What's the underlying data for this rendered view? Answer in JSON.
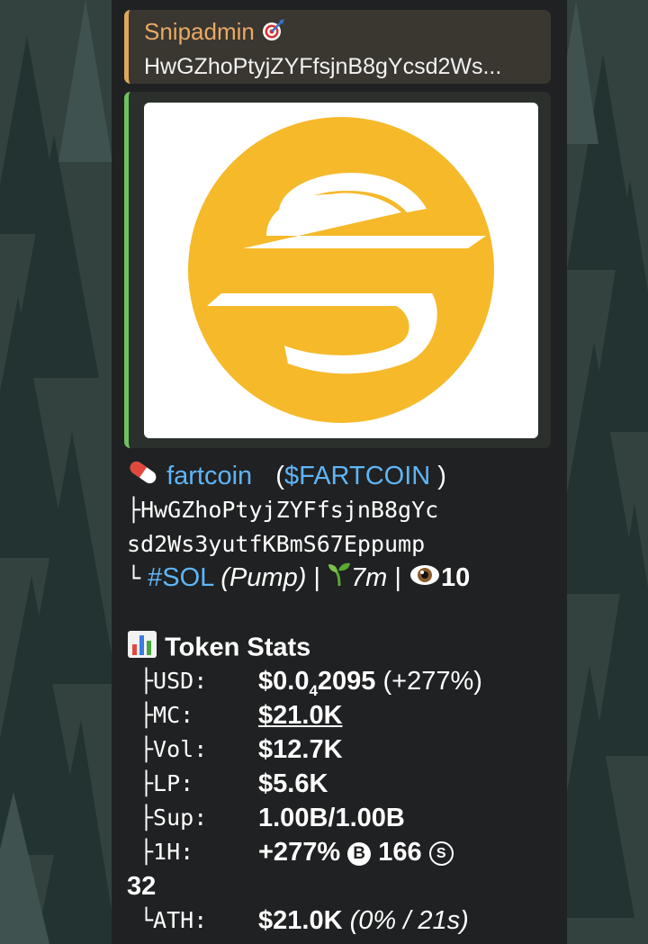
{
  "reply": {
    "sender": "Snipadmin",
    "sender_icon": "target-icon",
    "text": "HwGZhoPtyjZYFfsjnB8gYcsd2Ws..."
  },
  "preview": {
    "image_icon": "s-coin-logo-icon",
    "logo_color": "#F5B92A"
  },
  "token": {
    "name": "fartcoin",
    "symbol_open": "(",
    "symbol": "$FARTCOIN",
    "symbol_close": " )",
    "address_prefix": "├",
    "address_line1": "HwGZhoPtyjZYFfsjnB8gYc",
    "address_line2": "sd2Ws3yutfKBmS67Eppump",
    "chain_prefix": "└",
    "chain": "#SOL",
    "platform": "(Pump)",
    "sep1": " | ",
    "age": "7m",
    "sep2": " | ",
    "views": "10"
  },
  "stats": {
    "title": "Token Stats",
    "usd_label": "├USD:",
    "usd_value_main": "$0.0",
    "usd_value_sub": "4",
    "usd_value_rest": "2095",
    "usd_change": " (+277%)",
    "mc_label": "├MC:",
    "mc_value": "$21.0K",
    "vol_label": "├Vol:",
    "vol_value": "$12.7K",
    "lp_label": "├LP:",
    "lp_value": "$5.6K",
    "sup_label": "├Sup:",
    "sup_value": "1.00B/1.00B",
    "h1_label": "├1H:",
    "h1_change": "+277%",
    "h1_buy_badge": "B",
    "h1_buys": "166",
    "h1_sell_badge": "S",
    "h1_sells": "32",
    "ath_label": "└ATH:",
    "ath_value": "$21.0K",
    "ath_detail": "(0% / 21s)"
  },
  "colors": {
    "accent_reply": "#E0A85C",
    "accent_preview": "#6FC25F",
    "link": "#5EB5F7",
    "bubble": "#202122"
  }
}
